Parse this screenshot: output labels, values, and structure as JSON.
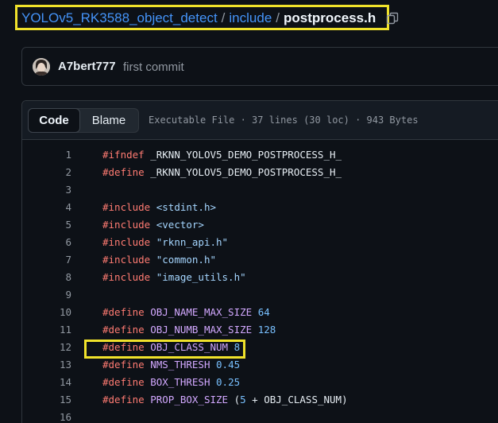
{
  "breadcrumb": {
    "repo": "YOLOv5_RK3588_object_detect",
    "separator": "/",
    "folder": "include",
    "file": "postprocess.h"
  },
  "commit": {
    "author": "A7bert777",
    "message": "first commit"
  },
  "file_header": {
    "tab_code": "Code",
    "tab_blame": "Blame",
    "meta": "Executable File · 37 lines (30 loc) · 943 Bytes"
  },
  "code": {
    "lines": [
      {
        "n": "1",
        "parts": [
          [
            "kw",
            "#"
          ],
          [
            "kw",
            "ifndef"
          ],
          [
            "plain",
            " _RKNN_YOLOV5_DEMO_POSTPROCESS_H_"
          ]
        ]
      },
      {
        "n": "2",
        "parts": [
          [
            "kw",
            "#"
          ],
          [
            "kw",
            "define"
          ],
          [
            "plain",
            " _RKNN_YOLOV5_DEMO_POSTPROCESS_H_"
          ]
        ]
      },
      {
        "n": "3",
        "parts": []
      },
      {
        "n": "4",
        "parts": [
          [
            "kw",
            "#"
          ],
          [
            "kw",
            "include"
          ],
          [
            "plain",
            " "
          ],
          [
            "str",
            "<stdint.h>"
          ]
        ]
      },
      {
        "n": "5",
        "parts": [
          [
            "kw",
            "#"
          ],
          [
            "kw",
            "include"
          ],
          [
            "plain",
            " "
          ],
          [
            "str",
            "<vector>"
          ]
        ]
      },
      {
        "n": "6",
        "parts": [
          [
            "kw",
            "#"
          ],
          [
            "kw",
            "include"
          ],
          [
            "plain",
            " "
          ],
          [
            "str",
            "\"rknn_api.h\""
          ]
        ]
      },
      {
        "n": "7",
        "parts": [
          [
            "kw",
            "#"
          ],
          [
            "kw",
            "include"
          ],
          [
            "plain",
            " "
          ],
          [
            "str",
            "\"common.h\""
          ]
        ]
      },
      {
        "n": "8",
        "parts": [
          [
            "kw",
            "#"
          ],
          [
            "kw",
            "include"
          ],
          [
            "plain",
            " "
          ],
          [
            "str",
            "\"image_utils.h\""
          ]
        ]
      },
      {
        "n": "9",
        "parts": []
      },
      {
        "n": "10",
        "parts": [
          [
            "kw",
            "#"
          ],
          [
            "kw",
            "define"
          ],
          [
            "plain",
            " "
          ],
          [
            "dir",
            "OBJ_NAME_MAX_SIZE"
          ],
          [
            "plain",
            " "
          ],
          [
            "num",
            "64"
          ]
        ]
      },
      {
        "n": "11",
        "parts": [
          [
            "kw",
            "#"
          ],
          [
            "kw",
            "define"
          ],
          [
            "plain",
            " "
          ],
          [
            "dir",
            "OBJ_NUMB_MAX_SIZE"
          ],
          [
            "plain",
            " "
          ],
          [
            "num",
            "128"
          ]
        ]
      },
      {
        "n": "12",
        "parts": [
          [
            "kw",
            "#"
          ],
          [
            "kw",
            "define"
          ],
          [
            "plain",
            " "
          ],
          [
            "dir",
            "OBJ_CLASS_NUM"
          ],
          [
            "plain",
            " "
          ],
          [
            "num",
            "8"
          ]
        ]
      },
      {
        "n": "13",
        "parts": [
          [
            "kw",
            "#"
          ],
          [
            "kw",
            "define"
          ],
          [
            "plain",
            " "
          ],
          [
            "dir",
            "NMS_THRESH"
          ],
          [
            "plain",
            " "
          ],
          [
            "num",
            "0.45"
          ]
        ]
      },
      {
        "n": "14",
        "parts": [
          [
            "kw",
            "#"
          ],
          [
            "kw",
            "define"
          ],
          [
            "plain",
            " "
          ],
          [
            "dir",
            "BOX_THRESH"
          ],
          [
            "plain",
            " "
          ],
          [
            "num",
            "0.25"
          ]
        ]
      },
      {
        "n": "15",
        "parts": [
          [
            "kw",
            "#"
          ],
          [
            "kw",
            "define"
          ],
          [
            "plain",
            " "
          ],
          [
            "dir",
            "PROP_BOX_SIZE"
          ],
          [
            "plain",
            " ("
          ],
          [
            "num",
            "5"
          ],
          [
            "plain",
            " + OBJ_CLASS_NUM)"
          ]
        ]
      },
      {
        "n": "16",
        "parts": []
      }
    ]
  },
  "colors": {
    "highlight": "#f0e22b",
    "link": "#4493f8",
    "keyword": "#ff7b72",
    "macro": "#d2a8ff",
    "string": "#a5d6ff",
    "number": "#79c0ff"
  },
  "icons": {
    "copy": "copy-icon",
    "avatar": "avatar"
  }
}
